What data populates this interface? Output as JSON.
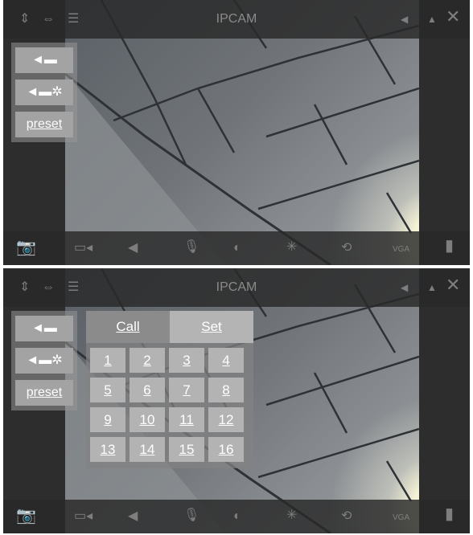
{
  "header": {
    "title": "IPCAM"
  },
  "icons": {
    "vertical_flip": "vertical-flip-icon",
    "horizontal_flip": "horizontal-flip-icon",
    "menu": "menu-icon",
    "speaker_small": "speaker-icon",
    "warning": "warning-icon",
    "close": "close-icon"
  },
  "ptz_panel": {
    "light_off_label": "light-icon",
    "light_on_label": "light-on-icon",
    "preset_label": "preset"
  },
  "preset_panel": {
    "call_label": "Call",
    "set_label": "Set",
    "numbers": [
      "1",
      "2",
      "3",
      "4",
      "5",
      "6",
      "7",
      "8",
      "9",
      "10",
      "11",
      "12",
      "13",
      "14",
      "15",
      "16"
    ]
  },
  "bottom_toolbar": {
    "snapshot": "camera-icon",
    "record": "video-record-icon",
    "audio": "speaker-icon",
    "mic": "microphone-icon",
    "contrast": "contrast-icon",
    "brightness": "brightness-icon",
    "reset": "reset-icon",
    "resolution_label": "VGA",
    "fullscreen": "fullscreen-icon"
  }
}
